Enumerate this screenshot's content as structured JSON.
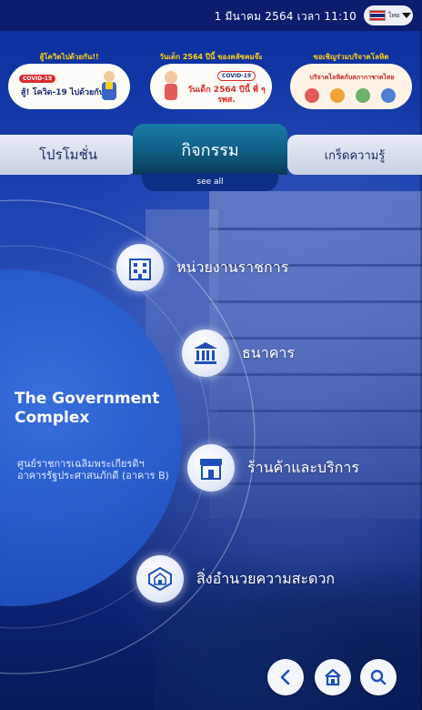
{
  "header": {
    "datetime": "1 มีนาคม 2564  เวลา 11:10",
    "language": "ไทย"
  },
  "banners": [
    {
      "title": "สู้โควิดไปด้วยกัน!!",
      "badge": "COVID-19",
      "headline": "สู้! โควิด-19 ไปด้วยกัน"
    },
    {
      "title": "วันเด็ก 2564 ปีนี้ ของคลัซคมจ๊ะ",
      "badge": "COVID-19",
      "headline": "วันเด็ก 2564 ปีนี้ พี่ ๆ รพส."
    },
    {
      "title": "ขอเชิญร่วมบริจาคโลหิต",
      "badge": "",
      "headline": "บริจาคโลหิตกับสภากาชาดไทย"
    }
  ],
  "tabs": {
    "promotion": "โปรโมชั่น",
    "activity": "กิจกรรม",
    "knowledge": "เกร็ดความรู้",
    "see_all": "see all"
  },
  "info": {
    "title": "The Government Complex",
    "subtitle_line1": "ศูนย์ราชการเฉลิมพระเกียรติฯ",
    "subtitle_line2": "อาคารรัฐประศาสนภักดี (อาคาร B)"
  },
  "menu": [
    {
      "label": "หน่วยงานราชการ",
      "icon": "office-building-icon"
    },
    {
      "label": "ธนาคาร",
      "icon": "bank-icon"
    },
    {
      "label": "ร้านค้าและบริการ",
      "icon": "shop-icon"
    },
    {
      "label": "สิ่งอำนวยความสะดวก",
      "icon": "facilities-icon"
    }
  ],
  "nav": {
    "back_icon": "back-icon",
    "home_icon": "home-icon",
    "search_icon": "search-icon"
  },
  "colors": {
    "accent_yellow": "#ffd21a",
    "tab_active": "#0f5d82",
    "background_blue": "#1a3fae"
  }
}
